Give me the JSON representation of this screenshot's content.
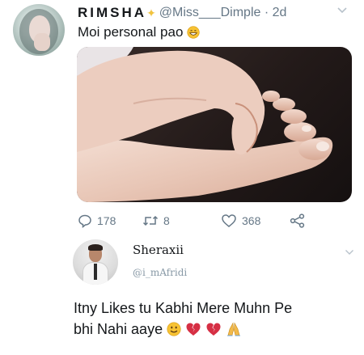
{
  "tweet": {
    "display_name": "RIMSHA",
    "handle": "@Miss___Dimple",
    "time": "· 2d",
    "text": "Moi personal pao",
    "actions": {
      "replies": "178",
      "retweets": "8",
      "likes": "368"
    }
  },
  "reply": {
    "display_name": "Sheraxii",
    "handle": "@i_mAfridi",
    "text_line1": "Itny Likes tu Kabhi Mere Muhn Pe",
    "text_line2": "bhi Nahi aaye"
  },
  "icons": {
    "sparkle": "sparkle-icon",
    "grin": "grinning-face-emoji",
    "smile": "slightly-smiling-face-emoji",
    "broken_heart": "broken-heart-emoji",
    "pray": "folded-hands-emoji",
    "reply": "reply-icon",
    "retweet": "retweet-icon",
    "like": "heart-icon",
    "share": "share-icon",
    "more": "chevron-down-icon"
  },
  "colors": {
    "text": "#14171a",
    "muted": "#657786",
    "sparkle": "#f1c33f",
    "broken_heart": "#d62f44"
  }
}
